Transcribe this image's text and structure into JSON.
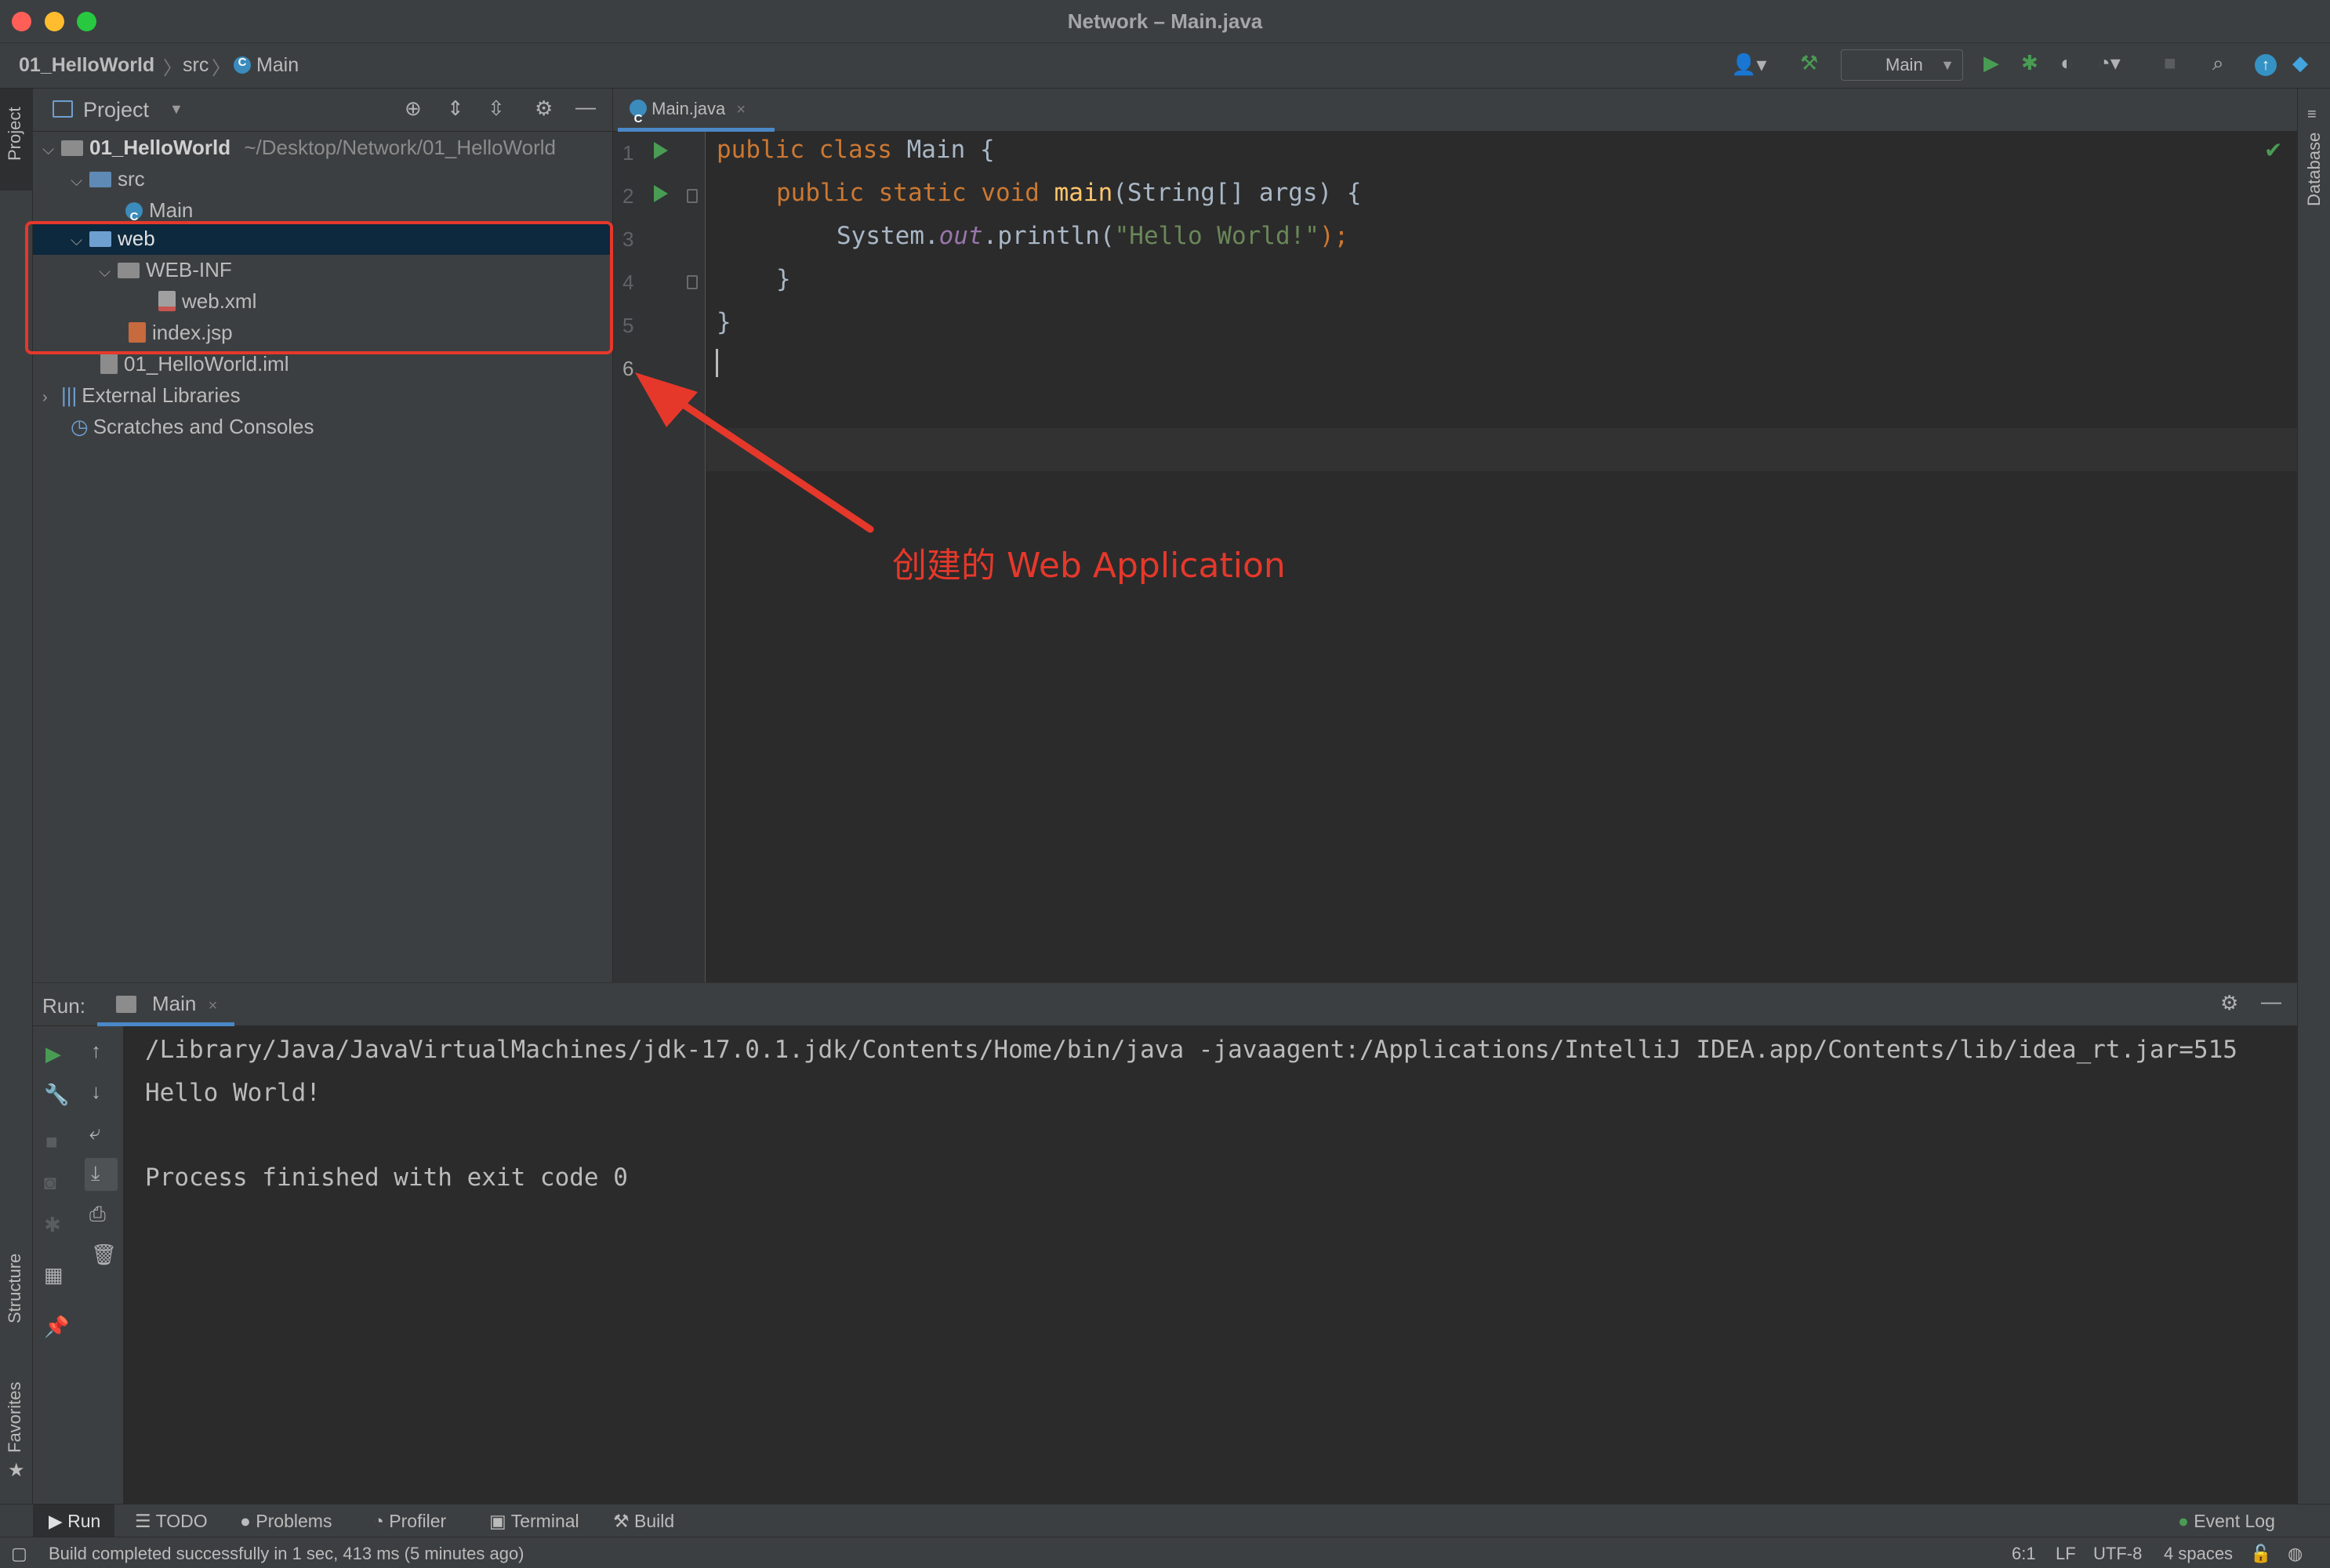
{
  "window": {
    "title": "Network – Main.java"
  },
  "breadcrumb": {
    "project": "01_HelloWorld",
    "folder": "src",
    "file": "Main"
  },
  "toolbar": {
    "run_config": "Main"
  },
  "left_stripe": {
    "project": "Project",
    "structure": "Structure",
    "favorites": "Favorites"
  },
  "right_stripe": {
    "database": "Database"
  },
  "project_panel": {
    "title": "Project",
    "tree": [
      {
        "label": "01_HelloWorld",
        "path": "~/Desktop/Network/01_HelloWorld"
      },
      {
        "label": "src"
      },
      {
        "label": "Main"
      },
      {
        "label": "web"
      },
      {
        "label": "WEB-INF"
      },
      {
        "label": "web.xml"
      },
      {
        "label": "index.jsp"
      },
      {
        "label": "01_HelloWorld.iml"
      },
      {
        "label": "External Libraries"
      },
      {
        "label": "Scratches and Consoles"
      }
    ]
  },
  "editor": {
    "tab": "Main.java",
    "line_numbers": [
      "1",
      "2",
      "3",
      "4",
      "5",
      "6"
    ],
    "code": {
      "l1_kw": "public class ",
      "l1_rest": "Main {",
      "l2_kw": "public static void ",
      "l2_fn": "main",
      "l2_rest": "(String[] args) {",
      "l3_a": "System.",
      "l3_it": "out",
      "l3_b": ".println(",
      "l3_str": "\"Hello World!\"",
      "l3_c": ");",
      "l4": "}",
      "l5": "}"
    }
  },
  "annotation": {
    "text": "创建的 Web Application",
    "color": "#e5382b"
  },
  "run_panel": {
    "label": "Run:",
    "tab": "Main",
    "console": [
      "/Library/Java/JavaVirtualMachines/jdk-17.0.1.jdk/Contents/Home/bin/java -javaagent:/Applications/IntelliJ IDEA.app/Contents/lib/idea_rt.jar=515",
      "Hello World!",
      "",
      "Process finished with exit code 0"
    ]
  },
  "bottom_tabs": {
    "run": "Run",
    "todo": "TODO",
    "problems": "Problems",
    "profiler": "Profiler",
    "terminal": "Terminal",
    "build": "Build",
    "event_log": "Event Log"
  },
  "status": {
    "message": "Build completed successfully in 1 sec, 413 ms (5 minutes ago)",
    "position": "6:1",
    "line_sep": "LF",
    "encoding": "UTF-8",
    "indent": "4 spaces"
  },
  "colors": {
    "accent": "#4a88c7",
    "run_green": "#499c54",
    "annotation_red": "#e5382b"
  }
}
